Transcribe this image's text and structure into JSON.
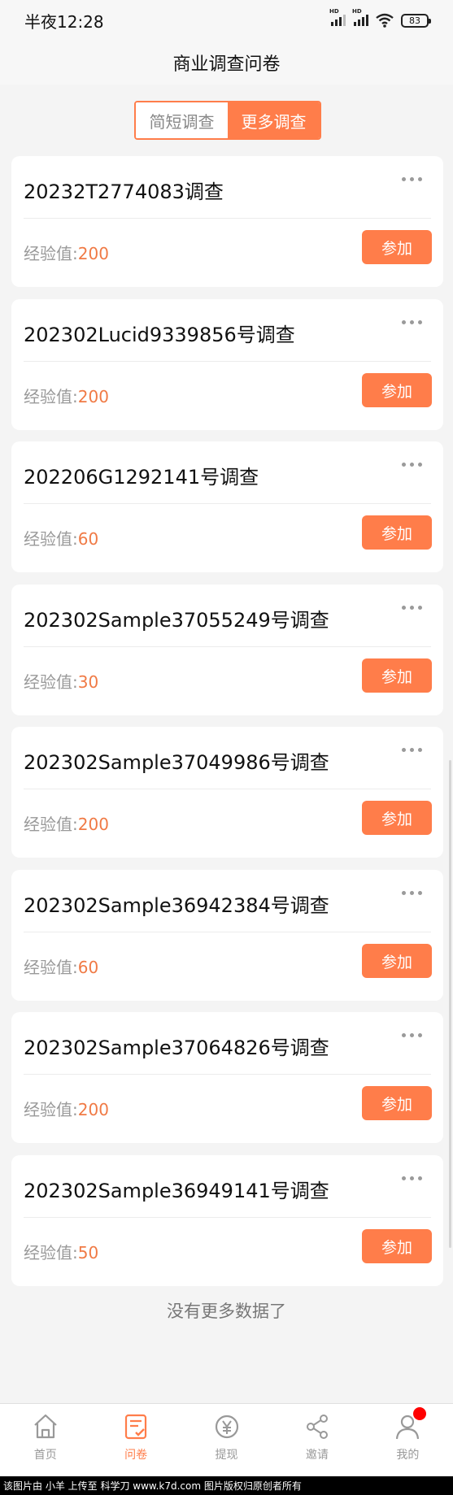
{
  "status": {
    "time": "半夜12:28",
    "battery": "83",
    "hd": "HD"
  },
  "header": {
    "title": "商业调查问卷"
  },
  "segment": {
    "tabs": [
      {
        "label": "简短调查"
      },
      {
        "label": "更多调查"
      }
    ]
  },
  "survey": {
    "exp_label": "经验值:",
    "join_label": "参加",
    "items": [
      {
        "title": "20232T2774083调查",
        "exp": "200"
      },
      {
        "title": "202302Lucid9339856号调查",
        "exp": "200"
      },
      {
        "title": "202206G1292141号调查",
        "exp": "60"
      },
      {
        "title": "202302Sample37055249号调查",
        "exp": "30"
      },
      {
        "title": "202302Sample37049986号调查",
        "exp": "200"
      },
      {
        "title": "202302Sample36942384号调查",
        "exp": "60"
      },
      {
        "title": "202302Sample37064826号调查",
        "exp": "200"
      },
      {
        "title": "202302Sample36949141号调查",
        "exp": "50"
      }
    ]
  },
  "list_end_text": "没有更多数据了",
  "tabbar": {
    "items": [
      {
        "label": "首页",
        "icon": "home-icon"
      },
      {
        "label": "问卷",
        "icon": "survey-icon"
      },
      {
        "label": "提现",
        "icon": "yen-icon"
      },
      {
        "label": "邀请",
        "icon": "share-icon"
      },
      {
        "label": "我的",
        "icon": "user-icon"
      }
    ]
  },
  "footer": {
    "text": "该图片由 小羊 上传至 科学刀 www.k7d.com 图片版权归原创者所有"
  },
  "colors": {
    "accent": "#ff7d4a",
    "exp_value": "#f07a45",
    "badge": "#ff0000"
  }
}
